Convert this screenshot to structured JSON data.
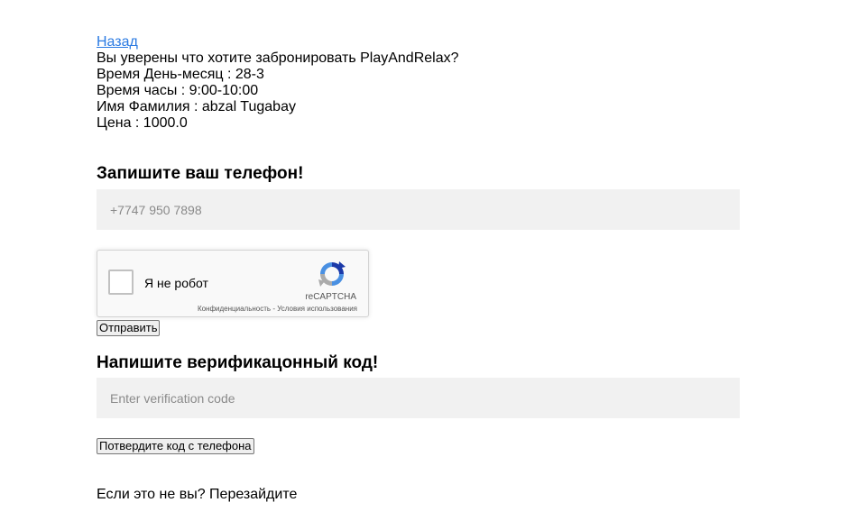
{
  "booking": {
    "back_link": "Назад",
    "confirm_question": "Вы уверены что хотите забронировать PlayAndRelax?",
    "date_line": "Время День-месяц : 28-3",
    "time_line": "Время часы : 9:00-10:00",
    "name_line": "Имя Фамилия : abzal Tugabay",
    "price_line": "Цена : 1000.0"
  },
  "phone_section": {
    "heading": "Запишите ваш телефон!",
    "placeholder": "+7747 950 7898"
  },
  "recaptcha": {
    "label": "Я не робот",
    "brand": "reCAPTCHA",
    "privacy_link": "Конфиденциальность",
    "separator": " - ",
    "terms_link": "Условия использования",
    "icon": "recaptcha-logo-icon"
  },
  "send_button": "Отправить",
  "code_section": {
    "heading": "Напишите верификацонный код!",
    "placeholder": "Enter verification code",
    "confirm_button": "Потвердите код с телефона"
  },
  "footer": {
    "text": "Если это не вы? Перезайдите"
  }
}
